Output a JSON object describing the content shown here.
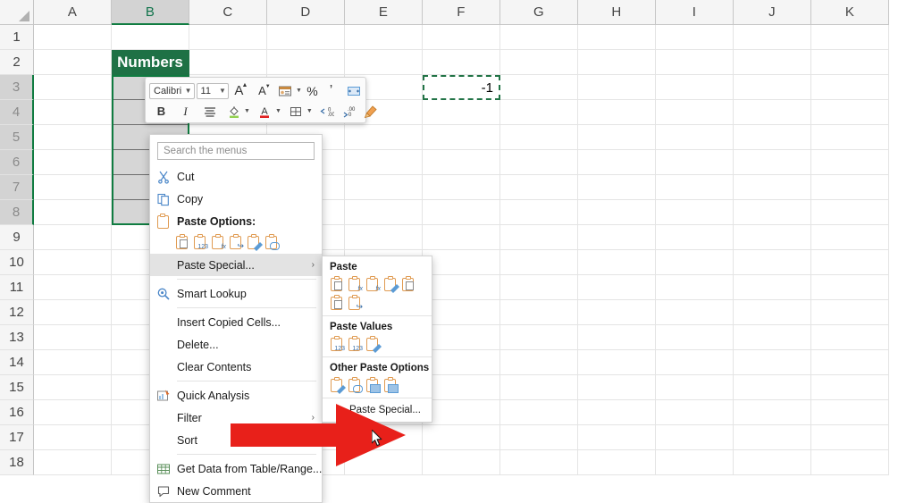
{
  "app": "Microsoft Excel",
  "grid": {
    "columns": [
      "A",
      "B",
      "C",
      "D",
      "E",
      "F",
      "G",
      "H",
      "I",
      "J",
      "K"
    ],
    "selected_column": "B",
    "rows": [
      "1",
      "2",
      "3",
      "4",
      "5",
      "6",
      "7",
      "8",
      "9",
      "10",
      "11",
      "12",
      "13",
      "14",
      "15",
      "16",
      "17",
      "18"
    ],
    "selected_rows": [
      "3",
      "4",
      "5",
      "6",
      "7",
      "8"
    ],
    "header_cell": {
      "ref": "B2",
      "text": "Numbers",
      "fill": "#1e7145",
      "font_color": "#ffffff"
    },
    "copied_cell": {
      "ref": "F3",
      "value": "-1",
      "border": "marching-ants",
      "border_color": "#217346"
    },
    "selection_range": "B3:B8",
    "selection_border_color": "#107c41"
  },
  "mini_toolbar": {
    "font_name": "Calibri",
    "font_size": "11",
    "row1": [
      {
        "name": "font-name-combo",
        "label": "Calibri"
      },
      {
        "name": "font-size-combo",
        "label": "11"
      },
      {
        "name": "increase-font-size",
        "label": "A"
      },
      {
        "name": "decrease-font-size",
        "label": "A"
      },
      {
        "name": "accounting-number-format",
        "label": ""
      },
      {
        "name": "percent-style",
        "label": "%"
      },
      {
        "name": "comma-style",
        "label": ","
      },
      {
        "name": "merge-and-center",
        "label": ""
      }
    ],
    "row2": [
      {
        "name": "bold",
        "label": "B"
      },
      {
        "name": "italic",
        "label": "I"
      },
      {
        "name": "align",
        "label": ""
      },
      {
        "name": "fill-color",
        "label": ""
      },
      {
        "name": "font-color",
        "label": "A"
      },
      {
        "name": "borders",
        "label": ""
      },
      {
        "name": "increase-decimal",
        "label": ""
      },
      {
        "name": "decrease-decimal",
        "label": ""
      },
      {
        "name": "format-painter",
        "label": ""
      }
    ]
  },
  "context_menu": {
    "search_placeholder": "Search the menus",
    "items": [
      {
        "label": "Cut",
        "icon": "scissors-icon",
        "bold": false,
        "highlight": false,
        "submenu": false
      },
      {
        "label": "Copy",
        "icon": "copy-icon",
        "bold": false,
        "highlight": false,
        "submenu": false
      },
      {
        "label": "Paste Options:",
        "icon": "clipboard-icon",
        "bold": true,
        "highlight": false,
        "submenu": false
      },
      {
        "label": "Paste Special...",
        "icon": "",
        "bold": false,
        "highlight": true,
        "submenu": true
      },
      {
        "label": "Smart Lookup",
        "icon": "smart-lookup-icon",
        "bold": false,
        "highlight": false,
        "submenu": false
      },
      {
        "label": "Insert Copied Cells...",
        "icon": "",
        "bold": false,
        "highlight": false,
        "submenu": false
      },
      {
        "label": "Delete...",
        "icon": "",
        "bold": false,
        "highlight": false,
        "submenu": false
      },
      {
        "label": "Clear Contents",
        "icon": "",
        "bold": false,
        "highlight": false,
        "submenu": false
      },
      {
        "label": "Quick Analysis",
        "icon": "quick-analysis-icon",
        "bold": false,
        "highlight": false,
        "submenu": false
      },
      {
        "label": "Filter",
        "icon": "",
        "bold": false,
        "highlight": false,
        "submenu": true
      },
      {
        "label": "Sort",
        "icon": "",
        "bold": false,
        "highlight": false,
        "submenu": true
      },
      {
        "label": "Get Data from Table/Range...",
        "icon": "table-icon",
        "bold": false,
        "highlight": false,
        "submenu": false
      },
      {
        "label": "New Comment",
        "icon": "comment-icon",
        "bold": false,
        "highlight": false,
        "submenu": false
      }
    ],
    "paste_option_icons": [
      "paste-icon",
      "paste-values-icon",
      "paste-formulas-icon",
      "paste-transpose-icon",
      "paste-formatting-icon",
      "paste-link-icon"
    ]
  },
  "submenu": {
    "groups": [
      {
        "title": "Paste",
        "icons": [
          "paste-icon",
          "paste-formulas-icon",
          "paste-formulas-number-formatting-icon",
          "paste-keep-source-formatting-icon",
          "paste-no-borders-icon",
          "paste-keep-source-column-widths-icon",
          "paste-transpose-icon"
        ]
      },
      {
        "title": "Paste Values",
        "icons": [
          "paste-values-icon",
          "paste-values-number-formatting-icon",
          "paste-values-source-formatting-icon"
        ]
      },
      {
        "title": "Other Paste Options",
        "icons": [
          "paste-formatting-icon",
          "paste-link-icon",
          "paste-picture-icon",
          "paste-linked-picture-icon"
        ]
      }
    ],
    "footer_item": "Paste Special..."
  },
  "annotation": {
    "type": "red-arrow",
    "color": "#e8201a",
    "points_to": "Paste Special..."
  }
}
